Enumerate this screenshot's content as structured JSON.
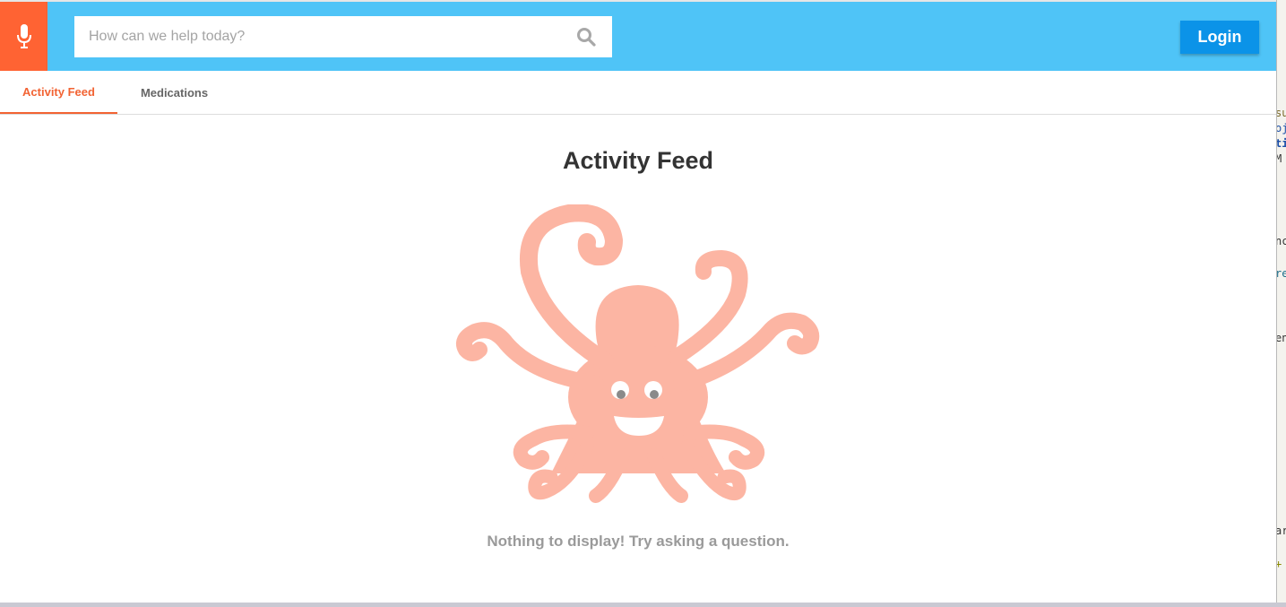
{
  "header": {
    "mic_icon": "microphone-icon",
    "search": {
      "placeholder": "How can we help today?",
      "icon": "search-icon"
    },
    "login_label": "Login"
  },
  "tabs": [
    {
      "label": "Activity Feed",
      "active": true
    },
    {
      "label": "Medications",
      "active": false
    }
  ],
  "main": {
    "title": "Activity Feed",
    "illustration": "octopus-illustration",
    "empty_message": "Nothing to display! Try asking a question."
  },
  "colors": {
    "header_bg": "#4fc4f7",
    "mic_bg": "#ff6333",
    "login_bg": "#0b93e8",
    "active_tab": "#f26333",
    "octopus": "#fcb5a3"
  }
}
